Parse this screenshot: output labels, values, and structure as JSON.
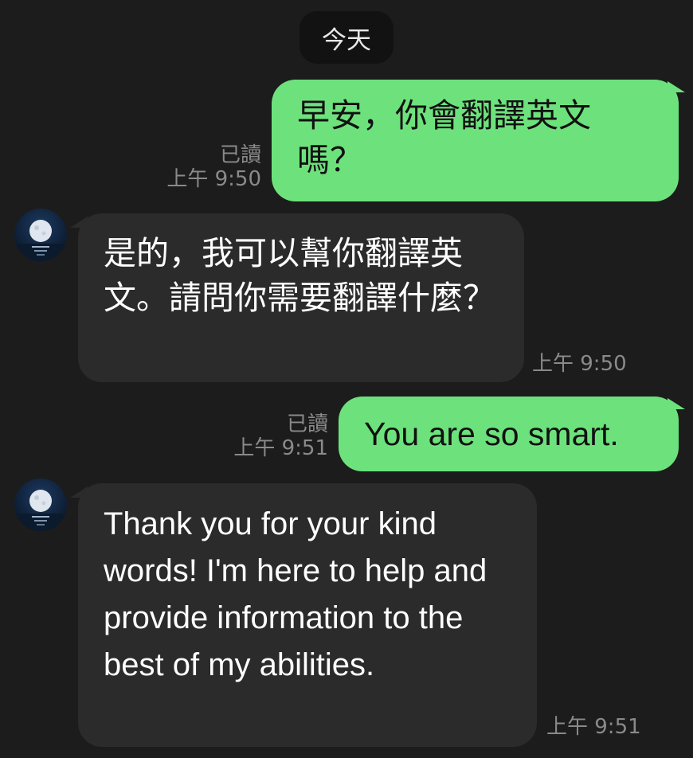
{
  "date_divider": "今天",
  "messages": [
    {
      "text": "早安，你會翻譯英文嗎？",
      "read": "已讀",
      "time": "上午 9:50"
    },
    {
      "text": "是的，我可以幫你翻譯英文。請問你需要翻譯什麼？",
      "time": "上午 9:50"
    },
    {
      "text": "You are so smart.",
      "read": "已讀",
      "time": "上午 9:51"
    },
    {
      "text": "Thank you for your kind words! I'm here to help and provide information to the best of my abilities.",
      "time": "上午 9:51"
    }
  ],
  "colors": {
    "background": "#1c1c1c",
    "outgoing_bubble": "#6de27c",
    "incoming_bubble": "#2b2b2b",
    "meta_text": "#8a8a8a"
  },
  "icons": [
    "moon-avatar-icon"
  ]
}
